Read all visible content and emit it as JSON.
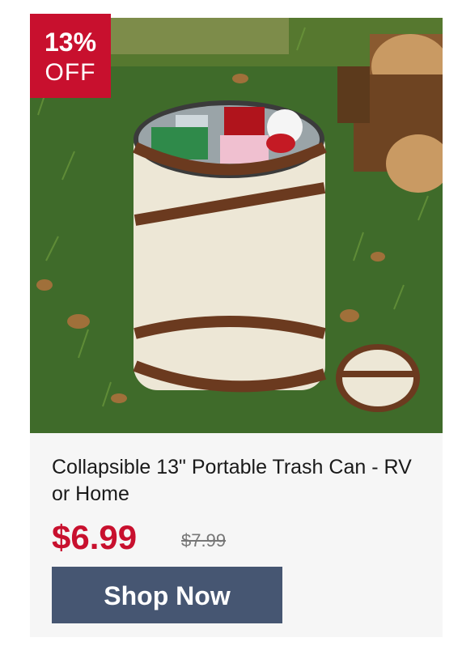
{
  "badge": {
    "percent": "13%",
    "label": "OFF"
  },
  "product": {
    "title": "Collapsible 13\" Portable Trash Can - RV or Home",
    "price": "$6.99",
    "was_price": "$7.99"
  },
  "cta": {
    "label": "Shop Now"
  },
  "colors": {
    "badge": "#c8102e",
    "price": "#c8102e",
    "button": "#465672",
    "card": "#f6f6f6"
  }
}
